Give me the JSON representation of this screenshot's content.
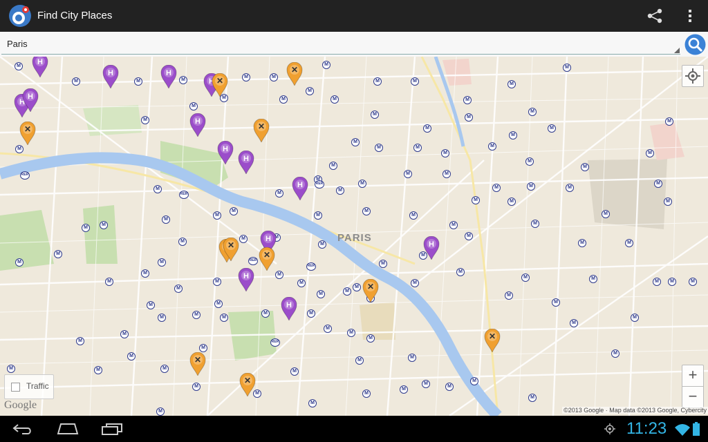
{
  "app": {
    "title": "Find City Places",
    "icon": "app-logo-icon"
  },
  "actions": {
    "share_icon": "share-icon",
    "overflow_icon": "overflow-menu-icon"
  },
  "search": {
    "value": "Paris",
    "button_icon": "search-icon"
  },
  "map": {
    "city_label": "PARIS",
    "metro_label": "M",
    "rer_label": "RER",
    "traffic_label": "Traffic",
    "traffic_checked": false,
    "google_logo": "Google",
    "attribution": "©2013 Google · Map data ©2013 Google, Cybercity",
    "zoom_in": "+",
    "zoom_out": "−",
    "pin_types": {
      "hotel": {
        "glyph": "H",
        "color": "#9b4dca"
      },
      "restaurant": {
        "glyph": "✕",
        "color": "#f0a030"
      }
    },
    "colors": {
      "land": "#efe9dc",
      "river": "#a8c8ef",
      "park": "#c8dfb0",
      "road": "#ffffff"
    }
  },
  "statusbar": {
    "time": "11:23",
    "time_color": "#33b5e5"
  },
  "navbar": {
    "back_icon": "back-icon",
    "home_icon": "home-icon",
    "recent_icon": "recent-apps-icon"
  }
}
